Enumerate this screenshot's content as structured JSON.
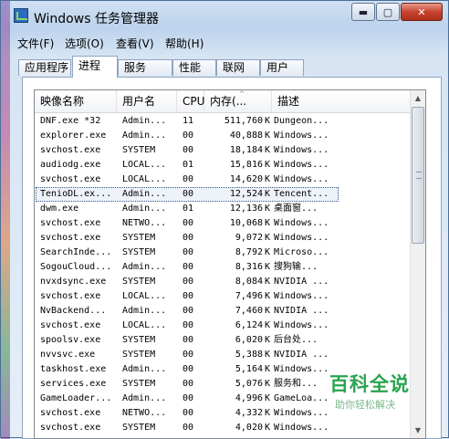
{
  "window": {
    "title": "Windows 任务管理器"
  },
  "titlebar_buttons": {
    "minimize": "▬",
    "maximize": "▢",
    "close": "✕"
  },
  "menu": [
    "文件(F)",
    "选项(O)",
    "查看(V)",
    "帮助(H)"
  ],
  "tabs": [
    "应用程序",
    "进程",
    "服务",
    "性能",
    "联网",
    "用户"
  ],
  "active_tab": "进程",
  "columns": {
    "name": "映像名称",
    "user": "用户名",
    "cpu": "CPU",
    "mem": "内存(...",
    "desc": "描述"
  },
  "sort_indicator": "^",
  "processes": [
    {
      "name": "DNF.exe *32",
      "user": "Admin...",
      "cpu": "11",
      "mem": "511,760",
      "unit": "K",
      "desc": "Dungeon..."
    },
    {
      "name": "explorer.exe",
      "user": "Admin...",
      "cpu": "00",
      "mem": "40,888",
      "unit": "K",
      "desc": "Windows..."
    },
    {
      "name": "svchost.exe",
      "user": "SYSTEM",
      "cpu": "00",
      "mem": "18,184",
      "unit": "K",
      "desc": "Windows..."
    },
    {
      "name": "audiodg.exe",
      "user": "LOCAL...",
      "cpu": "01",
      "mem": "15,816",
      "unit": "K",
      "desc": "Windows..."
    },
    {
      "name": "svchost.exe",
      "user": "LOCAL...",
      "cpu": "00",
      "mem": "14,620",
      "unit": "K",
      "desc": "Windows..."
    },
    {
      "name": "TenioDL.ex...",
      "user": "Admin...",
      "cpu": "00",
      "mem": "12,524",
      "unit": "K",
      "desc": "Tencent..."
    },
    {
      "name": "dwm.exe",
      "user": "Admin...",
      "cpu": "01",
      "mem": "12,136",
      "unit": "K",
      "desc": "桌面窗..."
    },
    {
      "name": "svchost.exe",
      "user": "NETWO...",
      "cpu": "00",
      "mem": "10,068",
      "unit": "K",
      "desc": "Windows..."
    },
    {
      "name": "svchost.exe",
      "user": "SYSTEM",
      "cpu": "00",
      "mem": "9,072",
      "unit": "K",
      "desc": "Windows..."
    },
    {
      "name": "SearchInde...",
      "user": "SYSTEM",
      "cpu": "00",
      "mem": "8,792",
      "unit": "K",
      "desc": "Microso..."
    },
    {
      "name": "SogouCloud...",
      "user": "Admin...",
      "cpu": "00",
      "mem": "8,316",
      "unit": "K",
      "desc": "搜狗输..."
    },
    {
      "name": "nvxdsync.exe",
      "user": "SYSTEM",
      "cpu": "00",
      "mem": "8,084",
      "unit": "K",
      "desc": "NVIDIA ..."
    },
    {
      "name": "svchost.exe",
      "user": "LOCAL...",
      "cpu": "00",
      "mem": "7,496",
      "unit": "K",
      "desc": "Windows..."
    },
    {
      "name": "NvBackend...",
      "user": "Admin...",
      "cpu": "00",
      "mem": "7,460",
      "unit": "K",
      "desc": "NVIDIA ..."
    },
    {
      "name": "svchost.exe",
      "user": "LOCAL...",
      "cpu": "00",
      "mem": "6,124",
      "unit": "K",
      "desc": "Windows..."
    },
    {
      "name": "spoolsv.exe",
      "user": "SYSTEM",
      "cpu": "00",
      "mem": "6,020",
      "unit": "K",
      "desc": "后台处..."
    },
    {
      "name": "nvvsvc.exe",
      "user": "SYSTEM",
      "cpu": "00",
      "mem": "5,388",
      "unit": "K",
      "desc": "NVIDIA ..."
    },
    {
      "name": "taskhost.exe",
      "user": "Admin...",
      "cpu": "00",
      "mem": "5,164",
      "unit": "K",
      "desc": "Windows..."
    },
    {
      "name": "services.exe",
      "user": "SYSTEM",
      "cpu": "00",
      "mem": "5,076",
      "unit": "K",
      "desc": "服务和..."
    },
    {
      "name": "GameLoader...",
      "user": "Admin...",
      "cpu": "00",
      "mem": "4,996",
      "unit": "K",
      "desc": "GameLoa..."
    },
    {
      "name": "svchost.exe",
      "user": "NETWO...",
      "cpu": "00",
      "mem": "4,332",
      "unit": "K",
      "desc": "Windows..."
    },
    {
      "name": "svchost.exe",
      "user": "SYSTEM",
      "cpu": "00",
      "mem": "4,020",
      "unit": "K",
      "desc": "Windows..."
    }
  ],
  "selected_process": "TenioDL.ex...",
  "scrollbar": {
    "up": "▲",
    "down": "▼"
  },
  "watermark": {
    "title": "百科全说",
    "subtitle": "助你轻松解决"
  }
}
